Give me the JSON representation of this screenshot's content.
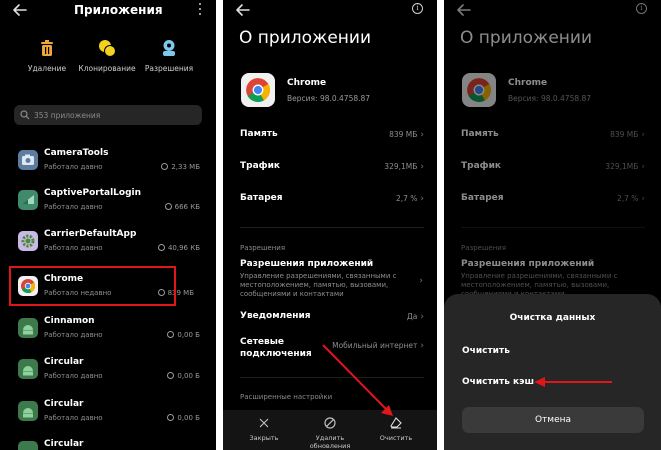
{
  "panel1": {
    "title": "Приложения",
    "actions": [
      {
        "label": "Удаление",
        "icon": "trash-icon"
      },
      {
        "label": "Клонирование",
        "icon": "clone-icon"
      },
      {
        "label": "Разрешения",
        "icon": "permissions-icon"
      }
    ],
    "search_placeholder": "353 приложения",
    "apps": [
      {
        "name": "CameraTools",
        "status": "Работало давно",
        "size": "2,33 МБ"
      },
      {
        "name": "CaptivePortalLogin",
        "status": "Работало давно",
        "size": "666 КБ"
      },
      {
        "name": "CarrierDefaultApp",
        "status": "Работало давно",
        "size": "40,96 КБ"
      },
      {
        "name": "Chrome",
        "status": "Работало недавно",
        "size": "839 МБ"
      },
      {
        "name": "Cinnamon",
        "status": "Работало давно",
        "size": "0,00 Б"
      },
      {
        "name": "Circular",
        "status": "Работало давно",
        "size": "0,00 Б"
      },
      {
        "name": "Circular",
        "status": "Работало давно",
        "size": "0,00 Б"
      },
      {
        "name": "Circular",
        "status": "",
        "size": ""
      }
    ]
  },
  "panel2": {
    "title": "О приложении",
    "app_name": "Chrome",
    "version": "Версия: 98.0.4758.87",
    "rows": [
      {
        "label": "Память",
        "value": "839 МБ"
      },
      {
        "label": "Трафик",
        "value": "329,1МБ"
      },
      {
        "label": "Батарея",
        "value": "2,7 %"
      }
    ],
    "permissions_section": "Разрешения",
    "perm_title": "Разрешения приложений",
    "perm_desc": "Управление разрешениями, связанными с местоположением, памятью, вызовами, сообщениями и контактами",
    "notifications": {
      "label": "Уведомления",
      "value": "Да"
    },
    "network": {
      "label": "Сетевые подключения",
      "value": "Мобильный интернет"
    },
    "advanced_section": "Расширенные настройки",
    "bottom": [
      {
        "label": "Закрыть"
      },
      {
        "label": "Удалить обновления"
      },
      {
        "label": "Очистить"
      }
    ]
  },
  "panel3": {
    "sheet_title": "Очистка данных",
    "option_clear": "Очистить",
    "option_clear_cache": "Очистить кэш",
    "cancel": "Отмена"
  },
  "colors": {
    "highlight": "#e0161b",
    "background": "#000000",
    "sheet": "#262626"
  }
}
